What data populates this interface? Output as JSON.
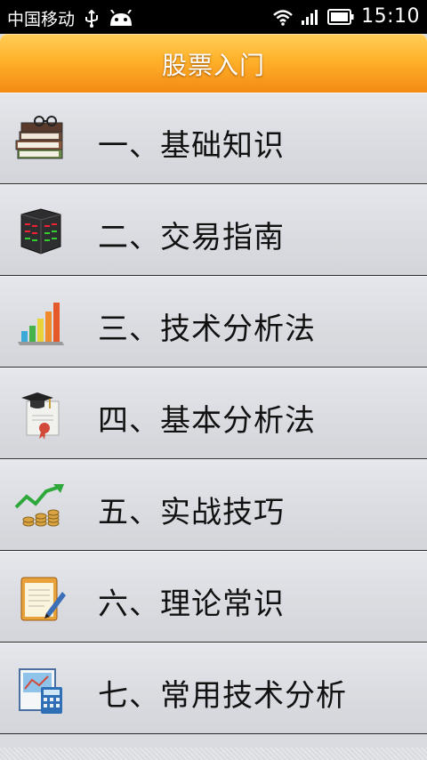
{
  "status_bar": {
    "carrier": "中国移动",
    "time": "15:10",
    "icons": [
      "usb-icon",
      "android-icon",
      "wifi-icon",
      "signal-icon",
      "battery-icon"
    ]
  },
  "header": {
    "title": "股票入门"
  },
  "menu": {
    "items": [
      {
        "label": "一、基础知识",
        "icon": "books-icon"
      },
      {
        "label": "二、交易指南",
        "icon": "stock-board-icon"
      },
      {
        "label": "三、技术分析法",
        "icon": "bar-chart-icon"
      },
      {
        "label": "四、基本分析法",
        "icon": "diploma-icon"
      },
      {
        "label": "五、实战技巧",
        "icon": "coins-growth-icon"
      },
      {
        "label": "六、理论常识",
        "icon": "notepad-icon"
      },
      {
        "label": "七、常用技术分析",
        "icon": "calculator-chart-icon"
      }
    ]
  },
  "colors": {
    "header_gradient_top": "#ffcf58",
    "header_gradient_bottom": "#f48a14",
    "list_background": "#d9dbe0",
    "status_bar": "#000000"
  }
}
